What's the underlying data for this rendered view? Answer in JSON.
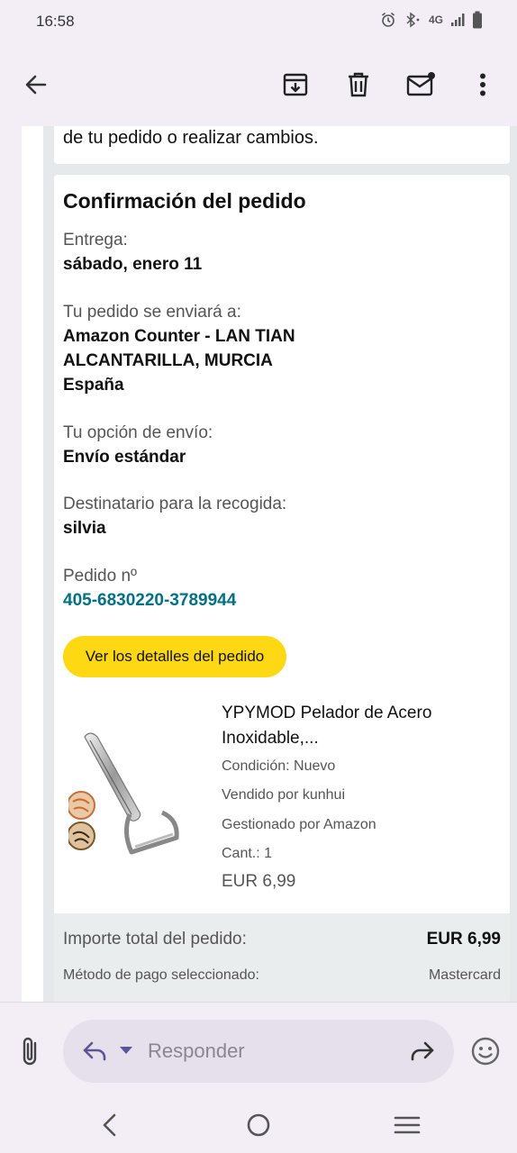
{
  "status": {
    "time": "16:58",
    "network": "4G"
  },
  "app_bar": {
    "back": "arrow-back-icon",
    "archive": "archive-icon",
    "delete": "trash-icon",
    "unread": "mark-unread-icon",
    "more": "more-vert-icon"
  },
  "email": {
    "top_text": "de tu pedido o realizar cambios.",
    "title": "Confirmación del pedido",
    "delivery_label": "Entrega:",
    "delivery_value": "sábado, enero 11",
    "ship_to_label": "Tu pedido se enviará a:",
    "ship_to_line1": "Amazon Counter - LAN TIAN",
    "ship_to_line2": "ALCANTARILLA, MURCIA",
    "ship_to_line3": "España",
    "shipping_option_label": "Tu opción de envío:",
    "shipping_option_value": "Envío estándar",
    "recipient_label": "Destinatario para la recogida:",
    "recipient_value": "silvia",
    "order_label": "Pedido nº",
    "order_number": "405-6830220-3789944",
    "details_button": "Ver los detalles del pedido",
    "product": {
      "title_line1": "YPYMOD Pelador de Acero",
      "title_line2": "Inoxidable,...",
      "condition": "Condición: Nuevo",
      "seller": "Vendido por kunhui",
      "fulfilled": "Gestionado por Amazon",
      "qty": "Cant.: 1",
      "price": "EUR 6,99"
    },
    "total_label": "Importe total del pedido:",
    "total_value": "EUR 6,99",
    "payment_label": "Método de pago seleccionado:",
    "payment_value": "Mastercard"
  },
  "reply": {
    "placeholder": "Responder"
  },
  "colors": {
    "accent_button": "#ffd814",
    "order_link": "#007185",
    "background": "#f3eef6"
  }
}
